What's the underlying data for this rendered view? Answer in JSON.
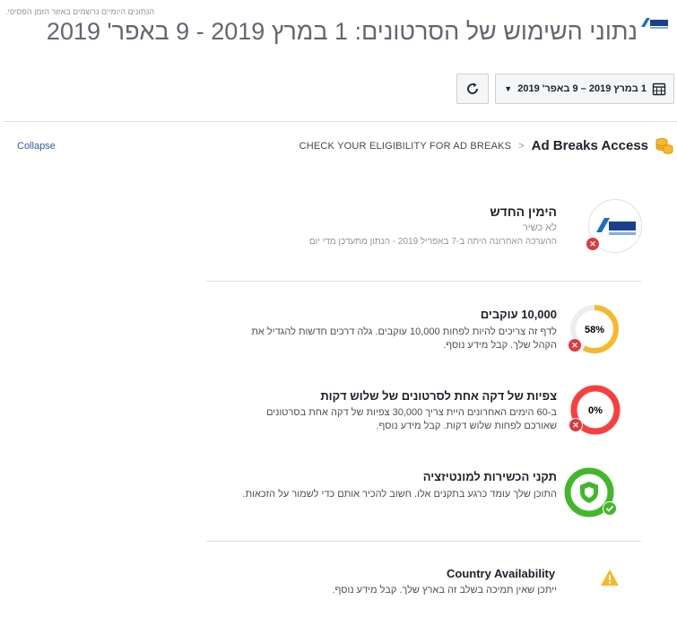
{
  "header": {
    "timezone_note": "הנתונים היומיים נרשמים באזור הזמן הפסיפי.",
    "title": "נתוני השימוש של הסרטונים: 1 במרץ 2019 - 9 באפר' 2019",
    "logo_text": "הימין החדש"
  },
  "toolbar": {
    "date_range": "1 במרץ 2019 – 9 באפר' 2019",
    "refresh_icon": "refresh-icon",
    "calendar_icon": "calendar-icon"
  },
  "breadcrumb": {
    "collapse": "Collapse",
    "step1": "CHECK YOUR ELIGIBILITY FOR AD BREAKS",
    "separator": ">",
    "current": "Ad Breaks Access"
  },
  "profile": {
    "name": "הימין החדש",
    "status": "לא כשיר",
    "review": "ההערכה האחרונה היתה ב-7 באפריל 2019 - הנתון מתעדכן מדי יום"
  },
  "requirements": [
    {
      "title": "10,000 עוקבים",
      "text": "לדף זה צריכים להיות לפחות 10,000 עוקבים. גלה דרכים חדשות להגדיל את הקהל שלך. קבל מידע נוסף.",
      "progress_label": "58%",
      "progress": 0.58,
      "ring_color": "#f7b928",
      "status": "fail"
    },
    {
      "title": "צפיות של דקה אחת לסרטונים של שלוש דקות",
      "text": "ב-60 הימים האחרונים היית צריך 30,000 צפיות של דקה אחת בסרטונים שאורכם לפחות שלוש דקות. קבל מידע נוסף.",
      "progress_label": "0%",
      "progress": 0.0,
      "ring_color": "#fa3e3e",
      "status": "fail"
    },
    {
      "title": "תקני הכשירות למונטיזציה",
      "text": "התוכן שלך עומד כרגע בתקנים אלו. חשוב להכיר אותם כדי לשמור על הזכאות.",
      "ring_color": "#42b72a",
      "status": "pass"
    }
  ],
  "country": {
    "title": "Country Availability",
    "text": "ייתכן שאין תמיכה בשלב זה בארץ שלך. קבל מידע נוסף."
  },
  "colors": {
    "link": "#365899",
    "fail": "#e0393e",
    "pass": "#42b72a",
    "warning": "#f7b928"
  }
}
